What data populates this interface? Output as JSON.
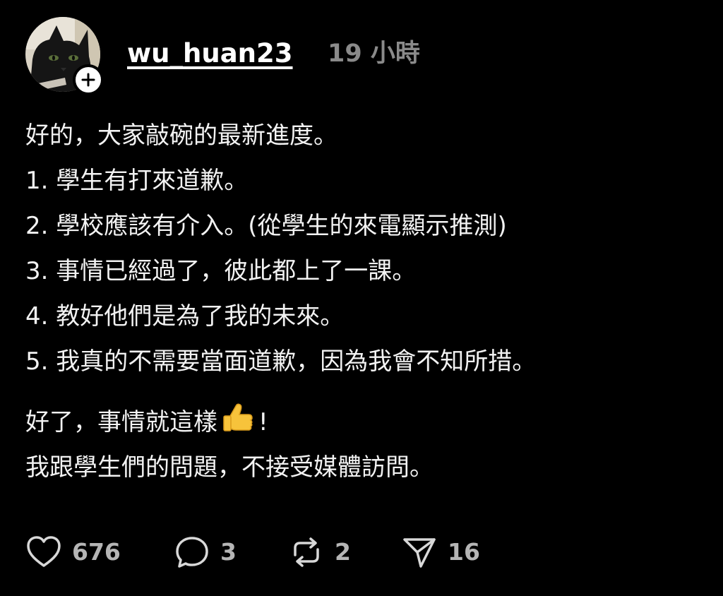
{
  "post": {
    "author": {
      "username": "wu_huan23",
      "timestamp": "19 小時",
      "avatar_icon": "black-cat-avatar",
      "follow_icon": "plus-icon"
    },
    "lines_block1": [
      "好的，大家敲碗的最新進度。",
      "1. 學生有打來道歉。",
      "2. 學校應該有介入。(從學生的來電顯示推測)",
      "3. 事情已經過了，彼此都上了一課。",
      "4. 教好他們是為了我的未來。",
      "5. 我真的不需要當面道歉，因為我會不知所措。"
    ],
    "line_block2_a_before": "好了，事情就這樣",
    "line_block2_a_after": "!",
    "line_block2_b": "我跟學生們的問題，不接受媒體訪問。",
    "emoji_icon": "thumbs-up-icon",
    "actions": {
      "likes": "676",
      "comments": "3",
      "reposts": "2",
      "shares": "16"
    }
  },
  "colors": {
    "background": "#000000",
    "text": "#f2f2f2",
    "muted": "#8a8a8a",
    "count": "#b5b5b5"
  }
}
